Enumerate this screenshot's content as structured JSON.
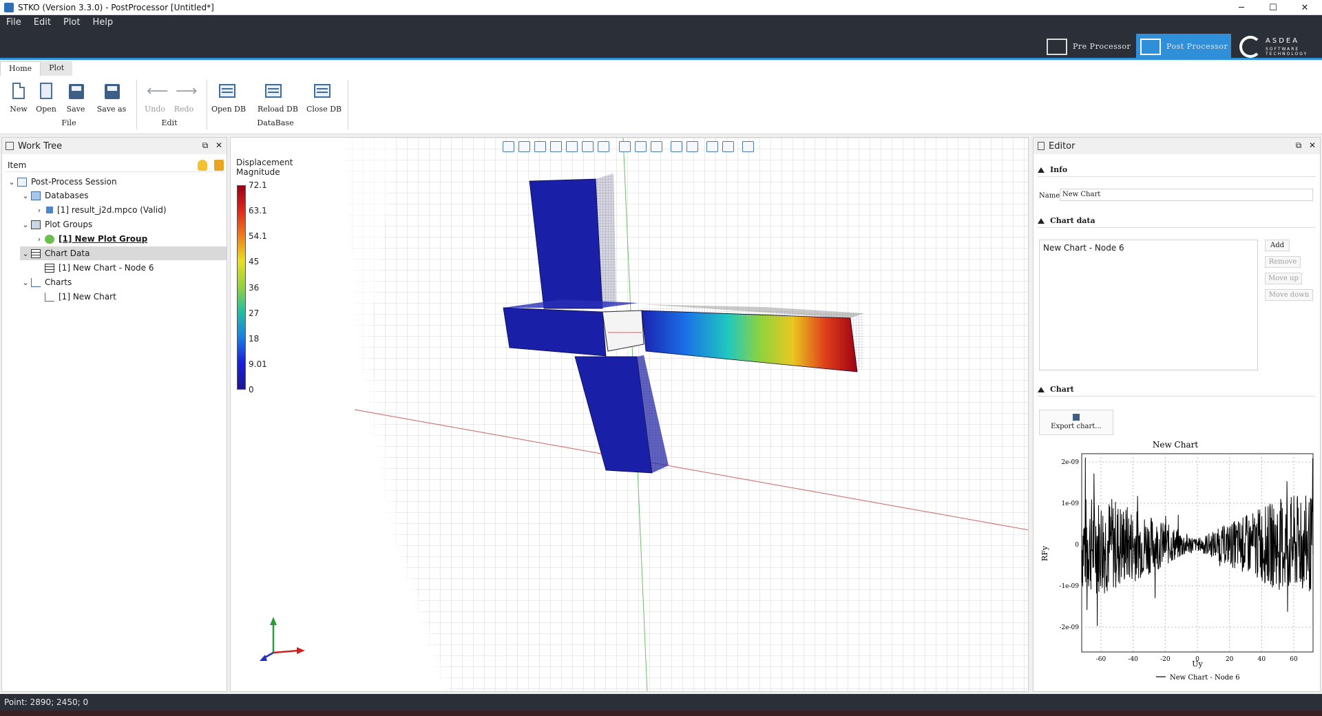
{
  "window": {
    "title": "STKO (Version 3.3.0) - PostProcessor [Untitled*]",
    "controls": {
      "minimize": "─",
      "maximize": "☐",
      "close": "✕"
    }
  },
  "menu": [
    "File",
    "Edit",
    "Plot",
    "Help"
  ],
  "mode_buttons": {
    "pre": "Pre Processor",
    "post": "Post Processor"
  },
  "brand": {
    "name": "ASDEA",
    "tagline": "SOFTWARE TECHNOLOGY"
  },
  "ribbon": {
    "tabs": [
      "Home",
      "Plot"
    ],
    "groups": {
      "file": {
        "title": "File",
        "buttons": [
          "New",
          "Open",
          "Save",
          "Save as"
        ]
      },
      "edit": {
        "title": "Edit",
        "buttons": [
          "Undo",
          "Redo"
        ]
      },
      "database": {
        "title": "DataBase",
        "buttons": [
          "Open DB",
          "Reload DB",
          "Close DB"
        ]
      }
    }
  },
  "work_tree": {
    "title": "Work Tree",
    "column": "Item",
    "items": [
      {
        "label": "Post-Process Session"
      },
      {
        "label": "Databases"
      },
      {
        "label": "[1] result_j2d.mpco (Valid)"
      },
      {
        "label": "Plot Groups"
      },
      {
        "label": "[1] New Plot Group"
      },
      {
        "label": "Chart Data"
      },
      {
        "label": "[1] New Chart - Node 6"
      },
      {
        "label": "Charts"
      },
      {
        "label": "[1] New Chart"
      }
    ]
  },
  "viewport": {
    "legend_title_1": "Displacement",
    "legend_title_2": "Magnitude",
    "legend_ticks": [
      "72.1",
      "63.1",
      "54.1",
      "45",
      "36",
      "27",
      "18",
      "9.01",
      "0"
    ],
    "colors": {
      "max": "#9e0012",
      "min": "#1a1894",
      "grid": "#c8c8c8"
    }
  },
  "editor": {
    "title": "Editor",
    "info": {
      "header": "Info",
      "name_label": "Name",
      "name_value": "New Chart"
    },
    "chart_data": {
      "header": "Chart data",
      "items": [
        "New Chart - Node 6"
      ],
      "buttons": {
        "add": "Add",
        "remove": "Remove",
        "move_up": "Move up",
        "move_down": "Move down"
      }
    },
    "chart": {
      "header": "Chart",
      "export": "Export chart..."
    }
  },
  "chart_data": {
    "type": "line",
    "title": "New Chart",
    "xlabel": "Uy",
    "ylabel": "RFy",
    "xlim": [
      -72,
      72
    ],
    "ylim": [
      -2.6e-09,
      2.2e-09
    ],
    "xticks": [
      "-60",
      "-40",
      "-20",
      "0",
      "20",
      "40",
      "60"
    ],
    "yticks": [
      "2e-09",
      "1e-09",
      "0",
      "-1e-09",
      "-2e-09"
    ],
    "series": [
      {
        "name": "New Chart - Node 6",
        "color": "#000000"
      }
    ],
    "legend": "bottom"
  },
  "status": {
    "text": "Point: 2890; 2450; 0"
  }
}
